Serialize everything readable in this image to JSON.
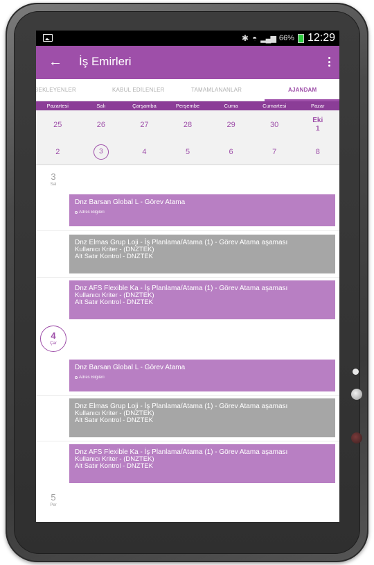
{
  "status_bar": {
    "battery": "66%",
    "time": "12:29",
    "icons": [
      "image-icon",
      "bluetooth-icon",
      "wifi-icon",
      "signal-icon",
      "battery-icon"
    ]
  },
  "toolbar": {
    "title": "İş Emirleri",
    "back_icon": "back-arrow-icon",
    "menu_icon": "overflow-menu-icon",
    "color": "#9e4fa9"
  },
  "tabs": [
    "BEKLEYENLER",
    "KABUL EDİLENLER",
    "TAMAMLANANLAR",
    "AJANDAM"
  ],
  "active_tab": "AJANDAM",
  "calendar": {
    "day_names": [
      "Pazartesi",
      "Salı",
      "Çarşamba",
      "Perşembe",
      "Cuma",
      "Cumartesi",
      "Pazar"
    ],
    "week1": [
      "25",
      "26",
      "27",
      "28",
      "29",
      "30"
    ],
    "month_label": "Eki",
    "month_day": "1",
    "week2": [
      "2",
      "3",
      "4",
      "5",
      "6",
      "7",
      "8"
    ],
    "selected": "3"
  },
  "agenda": {
    "days": [
      {
        "num": "3",
        "dow": "Sal"
      },
      {
        "num": "4",
        "dow": "Çar"
      },
      {
        "num": "5",
        "dow": "Per"
      }
    ],
    "events": [
      {
        "title": "Dnz Barsan Global L - Görev Atama",
        "sub": "Adres Bilgileri",
        "color": "purple"
      },
      {
        "title": "Dnz Elmas Grup Loji - İş Planlama/Atama (1) - Görev Atama aşaması",
        "line2": "Kullanıcı Kriter - (DNZTEK)",
        "line3": "Alt Satır Kontrol  - DNZTEK",
        "color": "gray"
      },
      {
        "title": "Dnz AFS Flexible Ka - İş Planlama/Atama (1) - Görev Atama aşaması",
        "line2": "Kullanıcı Kriter - (DNZTEK)",
        "line3": "Alt Satır Kontrol  - DNZTEK",
        "color": "purple"
      },
      {
        "title": "Dnz Barsan Global L - Görev Atama",
        "sub": "Adres Bilgileri",
        "color": "purple"
      },
      {
        "title": "Dnz Elmas Grup Loji - İş Planlama/Atama (1) - Görev Atama aşaması",
        "line2": "Kullanıcı Kriter - (DNZTEK)",
        "line3": "Alt Satır Kontrol  - DNZTEK",
        "color": "gray"
      },
      {
        "title": "Dnz AFS Flexible Ka - İş Planlama/Atama (1) - Görev Atama aşaması",
        "line2": "Kullanıcı Kriter - (DNZTEK)",
        "line3": "Alt Satır Kontrol  - DNZTEK",
        "color": "purple"
      }
    ]
  },
  "colors": {
    "accent": "#9e4fa9",
    "event_purple": "#b87fc3",
    "event_gray": "#a6a6a6"
  }
}
